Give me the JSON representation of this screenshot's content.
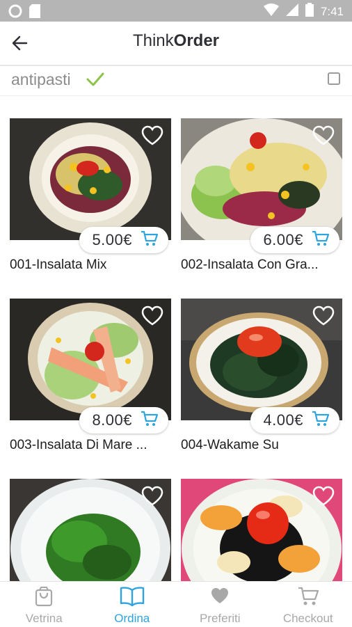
{
  "status": {
    "time": "7:41"
  },
  "header": {
    "title_regular": "Think",
    "title_bold": "Order"
  },
  "filter": {
    "category": "antipasti"
  },
  "items": [
    {
      "price": "5.00€",
      "name": "001-Insalata Mix"
    },
    {
      "price": "6.00€",
      "name": "002-Insalata Con Gra..."
    },
    {
      "price": "8.00€",
      "name": "003-Insalata Di Mare ..."
    },
    {
      "price": "4.00€",
      "name": "004-Wakame Su"
    },
    {
      "price": "",
      "name": ""
    },
    {
      "price": "",
      "name": ""
    }
  ],
  "nav": [
    {
      "label": "Vetrina",
      "icon": "bag-icon"
    },
    {
      "label": "Ordina",
      "icon": "book-icon"
    },
    {
      "label": "Preferiti",
      "icon": "heart-icon"
    },
    {
      "label": "Checkout",
      "icon": "cart-icon"
    }
  ],
  "colors": {
    "accent": "#2ea3dd",
    "check": "#8bc34a",
    "statusbar": "#b5b5b5"
  }
}
